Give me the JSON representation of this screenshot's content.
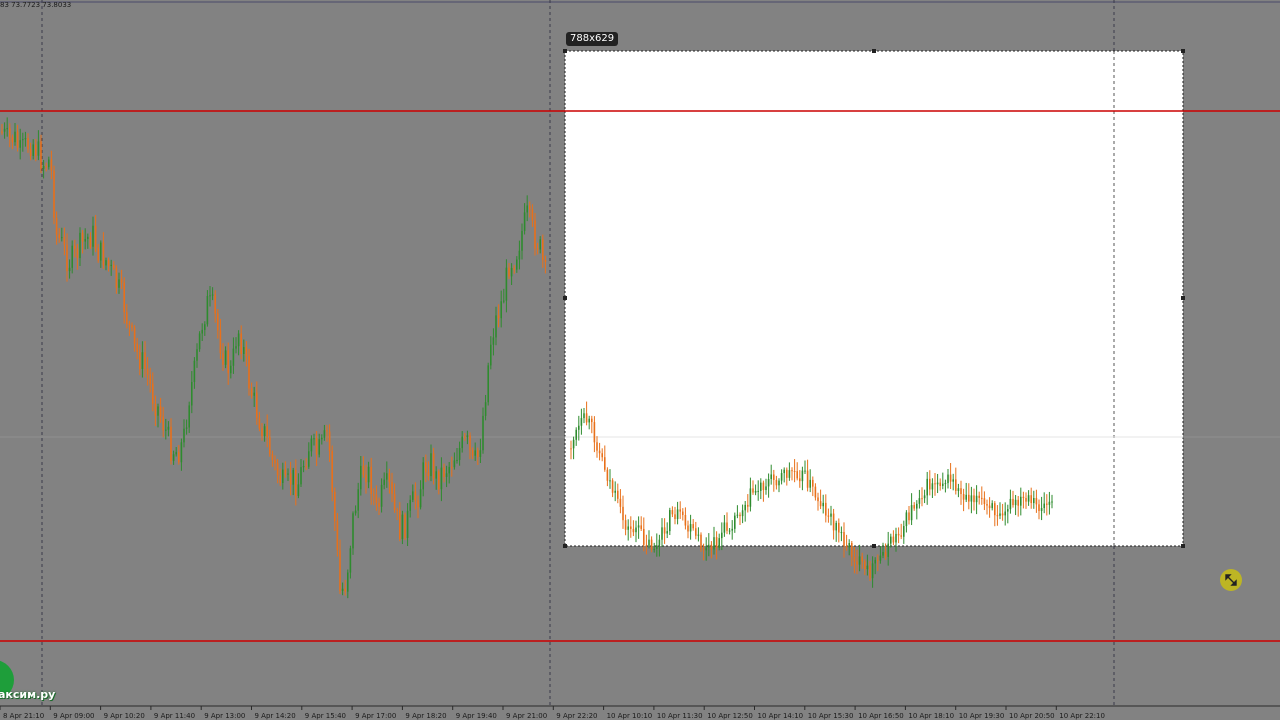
{
  "chart": {
    "ohlc_readout": "83 73.7723 73.8033",
    "selection_size": "788x629"
  },
  "watermark": {
    "text": "аксим.ру"
  },
  "chart_data": {
    "type": "candlestick",
    "title": "",
    "xlabel": "",
    "ylabel": "",
    "x_tick_labels": [
      "8 Apr 21:10",
      "9 Apr 09:00",
      "9 Apr 10:20",
      "9 Apr 11:40",
      "9 Apr 13:00",
      "9 Apr 14:20",
      "9 Apr 15:40",
      "9 Apr 17:00",
      "9 Apr 18:20",
      "9 Apr 19:40",
      "9 Apr 21:00",
      "9 Apr 22:20",
      "10 Apr 10:10",
      "10 Apr 11:30",
      "10 Apr 12:50",
      "10 Apr 14:10",
      "10 Apr 15:30",
      "10 Apr 16:50",
      "10 Apr 18:10",
      "10 Apr 19:30",
      "10 Apr 20:50",
      "10 Apr 22:10"
    ],
    "bull_color": "#2e8b2e",
    "bear_color": "#e8701a",
    "level_line_color": "#cc0000",
    "horizontal_levels": [
      "upper",
      "lower"
    ],
    "left_panel_close_path": [
      0.06,
      0.1,
      0.08,
      0.15,
      0.12,
      0.1,
      0.15,
      0.2,
      0.18,
      0.5,
      0.55,
      0.62,
      0.6,
      0.55,
      0.52,
      0.5,
      0.58,
      0.6,
      0.66,
      0.72,
      0.78,
      0.9,
      1.0,
      1.04,
      1.1,
      1.2,
      1.26,
      1.34,
      1.42,
      1.44,
      1.4,
      1.2,
      1.08,
      0.9,
      0.8,
      0.82,
      0.95,
      1.05,
      1.1,
      0.9,
      1.0,
      1.15,
      1.25,
      1.32,
      1.4,
      1.5,
      1.55,
      1.6,
      1.55,
      1.58,
      1.48,
      1.4,
      1.45,
      1.42,
      1.35,
      1.7,
      2.05,
      2.0,
      1.75,
      1.6,
      1.5,
      1.55,
      1.7,
      1.62,
      1.58,
      1.7,
      1.78,
      1.74,
      1.66,
      1.62,
      1.5,
      1.48,
      1.56,
      1.52,
      1.5,
      1.45,
      1.42,
      1.4,
      1.5,
      1.45,
      1.2,
      0.95,
      0.85,
      0.78,
      0.62,
      0.6,
      0.5,
      0.42,
      0.5,
      0.55,
      0.68
    ],
    "right_panel_close_path": [
      0.8,
      0.7,
      0.62,
      0.7,
      0.85,
      1.0,
      1.15,
      1.3,
      1.4,
      1.38,
      1.45,
      1.5,
      1.52,
      1.4,
      1.28,
      1.3,
      1.38,
      1.42,
      1.5,
      1.55,
      1.5,
      1.42,
      1.36,
      1.3,
      1.22,
      1.15,
      1.1,
      1.06,
      1.04,
      1.02,
      1.0,
      0.98,
      1.0,
      1.05,
      1.15,
      1.22,
      1.3,
      1.38,
      1.46,
      1.55,
      1.62,
      1.7,
      1.68,
      1.6,
      1.52,
      1.46,
      1.4,
      1.3,
      1.2,
      1.12,
      1.08,
      1.05,
      1.04,
      1.05,
      1.12,
      1.16,
      1.14,
      1.2,
      1.25,
      1.26,
      1.24,
      1.22,
      1.23,
      1.2,
      1.22,
      1.24,
      1.22,
      1.2
    ]
  }
}
